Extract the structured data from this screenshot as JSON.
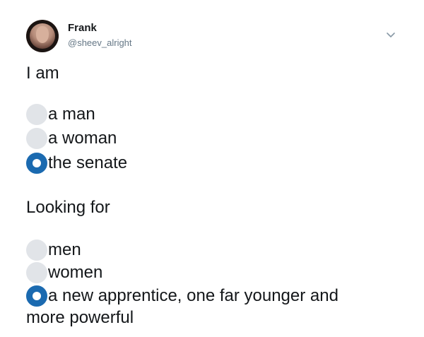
{
  "author": {
    "name": "Frank",
    "handle": "@sheev_alright",
    "avatar_icon": "user-avatar-icon",
    "menu_icon": "chevron-down-icon"
  },
  "tweet": {
    "line1": "I am",
    "group1": [
      {
        "label": "a man",
        "selected": false
      },
      {
        "label": "a woman",
        "selected": false
      },
      {
        "label": "the senate",
        "selected": true
      }
    ],
    "line2": "Looking for",
    "group2": [
      {
        "label": "men",
        "selected": false
      },
      {
        "label": "women",
        "selected": false
      },
      {
        "label": "a new apprentice, one far younger and",
        "selected": true
      }
    ],
    "continuation": "more powerful"
  },
  "colors": {
    "text": "#14171a",
    "handle": "#657786",
    "radio_empty": "#e1e4e8",
    "radio_selected": "#1b6ab0"
  }
}
